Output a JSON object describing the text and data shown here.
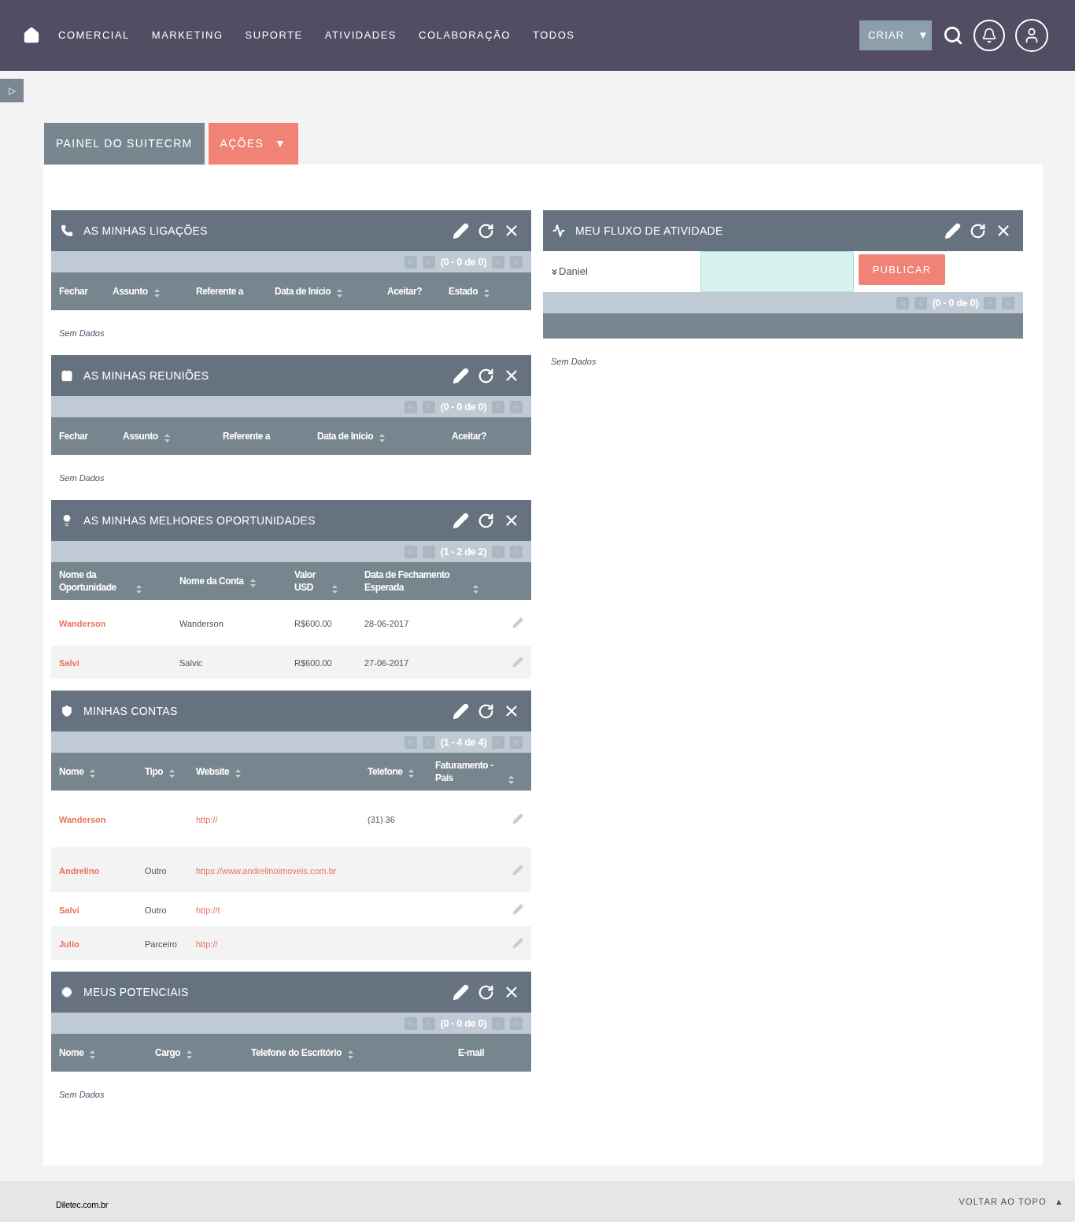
{
  "nav": {
    "items": [
      "COMERCIAL",
      "MARKETING",
      "SUPORTE",
      "ATIVIDADES",
      "COLABORAÇÃO",
      "TODOS"
    ],
    "create": "CRIAR",
    "create_caret": "▼"
  },
  "sidebar_toggle": "▷",
  "tabs": [
    {
      "label": "PAINEL DO SUITECRM",
      "kind": "tab",
      "selected": false
    },
    {
      "label": "AÇÕES",
      "kind": "menu",
      "caret": "▼",
      "selected": true
    }
  ],
  "left_dashlets": [
    {
      "title": "AS MINHAS LIGAÇÕES",
      "pagination": "(0 - 0 de 0)",
      "columns": [
        {
          "label": "Fechar",
          "sortable": false
        },
        {
          "label": "Assunto",
          "sortable": true
        },
        {
          "label": "Referente a",
          "sortable": false
        },
        {
          "label": "Data de Início",
          "sortable": true
        },
        {
          "label": "Aceitar?",
          "sortable": false
        },
        {
          "label": "Estado",
          "sortable": true
        }
      ],
      "empty": "Sem Dados"
    },
    {
      "title": "AS MINHAS REUNIÕES",
      "pagination": "(0 - 0 de 0)",
      "columns": [
        {
          "label": "Fechar",
          "sortable": false
        },
        {
          "label": "Assunto",
          "sortable": true
        },
        {
          "label": "Referente a",
          "sortable": false
        },
        {
          "label": "Data de Início",
          "sortable": true
        },
        {
          "label": "Aceitar?",
          "sortable": false
        }
      ],
      "empty": "Sem Dados"
    },
    {
      "title": "AS MINHAS MELHORES OPORTUNIDADES",
      "pagination": "(1 - 2 de 2)",
      "columns": [
        {
          "label": "Nome da Oportunidade",
          "sortable": true
        },
        {
          "label": "Nome da Conta",
          "sortable": true
        },
        {
          "label": "Valor USD",
          "sortable": true
        },
        {
          "label": "Data de Fechamento Esperada",
          "sortable": true
        }
      ],
      "rows": [
        {
          "cells": [
            {
              "text": "Wanderson",
              "kind": "link"
            },
            {
              "text": "Wanderson",
              "kind": "plain"
            },
            {
              "text": "R$600.00",
              "kind": "plain"
            },
            {
              "text": "28-06-2017",
              "kind": "plain"
            }
          ]
        },
        {
          "cells": [
            {
              "text": "Salvi",
              "kind": "link"
            },
            {
              "text": "Salvic",
              "kind": "plain"
            },
            {
              "text": "R$600.00",
              "kind": "plain"
            },
            {
              "text": "27-06-2017",
              "kind": "plain"
            }
          ]
        }
      ]
    },
    {
      "title": "MINHAS CONTAS",
      "pagination": "(1 - 4 de 4)",
      "columns": [
        {
          "label": "Nome",
          "sortable": true
        },
        {
          "label": "Tipo",
          "sortable": true
        },
        {
          "label": "Website",
          "sortable": true
        },
        {
          "label": "Telefone",
          "sortable": true
        },
        {
          "label": "Faturamento - País",
          "sortable": true
        }
      ],
      "rows": [
        {
          "cells": [
            {
              "text": "Wanderson",
              "kind": "link"
            },
            null,
            {
              "text": "http://",
              "kind": "link"
            },
            {
              "text": "(31) 36",
              "kind": "plain"
            }
          ]
        },
        {
          "cells": [
            {
              "text": "Andrelino",
              "kind": "link"
            },
            {
              "text": "Outro",
              "kind": "plain"
            },
            {
              "text": "https://www.andrelinoimoveis.com.br",
              "kind": "link"
            }
          ]
        },
        {
          "cells": [
            {
              "text": "Salvi",
              "kind": "link"
            },
            {
              "text": "Outro",
              "kind": "plain"
            },
            {
              "text": "http://t",
              "kind": "link"
            }
          ]
        },
        {
          "cells": [
            {
              "text": "Julio",
              "kind": "link"
            },
            {
              "text": "Parceiro",
              "kind": "plain"
            },
            {
              "text": "http://",
              "kind": "link"
            }
          ]
        }
      ]
    },
    {
      "title": "MEUS POTENCIAIS",
      "pagination": "(0 - 0 de 0)",
      "columns": [
        {
          "label": "Nome",
          "sortable": true
        },
        {
          "label": "Cargo",
          "sortable": true
        },
        {
          "label": "Telefone do Escritório",
          "sortable": true
        },
        {
          "label": "E-mail",
          "sortable": false
        }
      ],
      "empty": "Sem Dados"
    }
  ],
  "activity": {
    "title": "MEU FLUXO DE ATIVIDADE",
    "user": "Daniel",
    "post_button": "PUBLICAR",
    "pagination": "(0 - 0 de 0)",
    "empty": "Sem Dados"
  },
  "footer": {
    "site": "Diletec.com.br",
    "back_to_top": "VOLTAR AO TOPO",
    "back_icon": "▲"
  }
}
